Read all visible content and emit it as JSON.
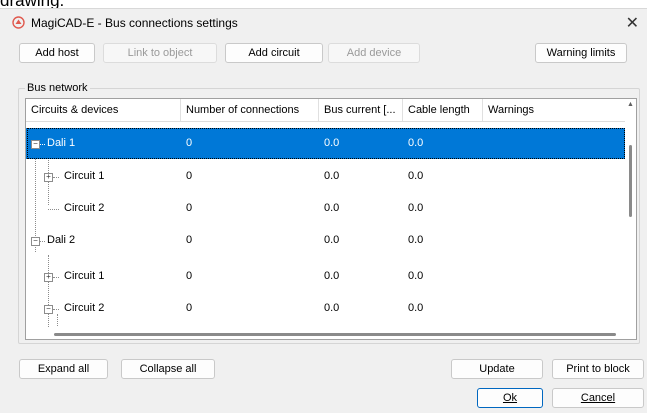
{
  "cropped_text": "drawing.",
  "window": {
    "title": "MagiCAD-E - Bus connections settings",
    "close_glyph": "✕"
  },
  "toolbar": {
    "add_host": "Add host",
    "link_to_object": "Link to object",
    "add_circuit": "Add circuit",
    "add_device": "Add device",
    "warning_limits": "Warning limits"
  },
  "bus_network": {
    "label": "Bus network",
    "columns": [
      "Circuits & devices",
      "Number of connections",
      "Bus current [...",
      "Cable length",
      "Warnings"
    ],
    "rows": [
      {
        "name": "Dali 1",
        "connections": "0",
        "current": "0.0",
        "cable": "0.0",
        "warnings": "",
        "expander": "−",
        "selected": true
      },
      {
        "name": "Circuit 1",
        "connections": "0",
        "current": "0.0",
        "cable": "0.0",
        "warnings": "",
        "expander": "+"
      },
      {
        "name": "Circuit 2",
        "connections": "0",
        "current": "0.0",
        "cable": "0.0",
        "warnings": "",
        "expander": ""
      },
      {
        "name": "Dali 2",
        "connections": "0",
        "current": "0.0",
        "cable": "0.0",
        "warnings": "",
        "expander": "−"
      },
      {
        "name": "Circuit 1",
        "connections": "0",
        "current": "0.0",
        "cable": "0.0",
        "warnings": "",
        "expander": "+"
      },
      {
        "name": "Circuit 2",
        "connections": "0",
        "current": "0.0",
        "cable": "0.0",
        "warnings": "",
        "expander": "−"
      }
    ]
  },
  "footer": {
    "expand_all": "Expand all",
    "collapse_all": "Collapse all",
    "update": "Update",
    "print_to_block": "Print to block",
    "ok": "Ok",
    "cancel": "Cancel"
  },
  "colors": {
    "selection": "#0078d7",
    "app_icon": "#e05a4f"
  }
}
